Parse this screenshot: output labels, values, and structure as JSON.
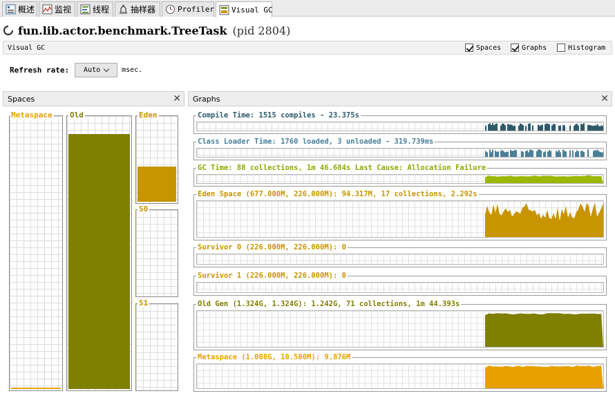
{
  "tabs": [
    {
      "label": "概述",
      "icon": "overview-icon",
      "active": false
    },
    {
      "label": "监视",
      "icon": "monitor-icon",
      "active": false
    },
    {
      "label": "线程",
      "icon": "threads-icon",
      "active": false
    },
    {
      "label": "抽样器",
      "icon": "sampler-icon",
      "active": false
    },
    {
      "label": "Profiler",
      "icon": "profiler-icon",
      "active": false
    },
    {
      "label": "Visual GC",
      "icon": "visualgc-icon",
      "active": true
    }
  ],
  "app": {
    "name": "fun.lib.actor.benchmark.TreeTask",
    "pid": "(pid 2804)"
  },
  "visual_gc": {
    "label": "Visual GC",
    "options": [
      {
        "label": "Spaces",
        "checked": true
      },
      {
        "label": "Graphs",
        "checked": true
      },
      {
        "label": "Histogram",
        "checked": false
      }
    ]
  },
  "refresh": {
    "label": "Refresh rate:",
    "value": "Auto",
    "unit": "msec."
  },
  "spaces_panel": {
    "title": "Spaces",
    "spaces": [
      {
        "name": "Metaspace",
        "fill": 0.005,
        "color": "#e8a000"
      },
      {
        "name": "Old",
        "fill": 0.94,
        "color": "#7f7f00"
      },
      {
        "name": "Eden",
        "fill": 0.42,
        "color": "#c89400"
      },
      {
        "name": "S0",
        "fill": 0.0,
        "color": "#e8a000"
      },
      {
        "name": "S1",
        "fill": 0.0,
        "color": "#e8a000"
      }
    ]
  },
  "graphs_panel": {
    "title": "Graphs",
    "graphs": [
      {
        "label": "Compile Time: 1515 compiles - 23.375s",
        "color": "#2f5a6b",
        "activity": "bursty",
        "level": 0.9
      },
      {
        "label": "Class Loader Time: 1760 loaded, 3 unloaded - 319.739ms",
        "color": "#4a7f9a",
        "activity": "bursty",
        "level": 0.9
      },
      {
        "label": "GC Time: 88 collections, 1m 46.684s  Last Cause: Allocation Failure",
        "color": "#9ab800",
        "activity": "steady",
        "level": 0.95
      },
      {
        "label": "Eden Space (677.000M, 226.000M): 94.317M, 17 collections, 2.292s",
        "color": "#c89400",
        "activity": "sawtooth",
        "level": 0.95
      },
      {
        "label": "Survivor 0 (226.000M, 226.000M): 0",
        "color": "#c89400",
        "activity": "none",
        "level": 0
      },
      {
        "label": "Survivor 1 (226.000M, 226.000M): 0",
        "color": "#c89400",
        "activity": "none",
        "level": 0
      },
      {
        "label": "Old Gen (1.324G, 1.324G): 1.242G, 71 collections, 1m 44.393s",
        "color": "#7f7f00",
        "activity": "steady",
        "level": 0.94
      },
      {
        "label": "Metaspace (1.008G, 10.500M): 9.876M",
        "color": "#e8a000",
        "activity": "steady",
        "level": 0.94
      }
    ]
  }
}
